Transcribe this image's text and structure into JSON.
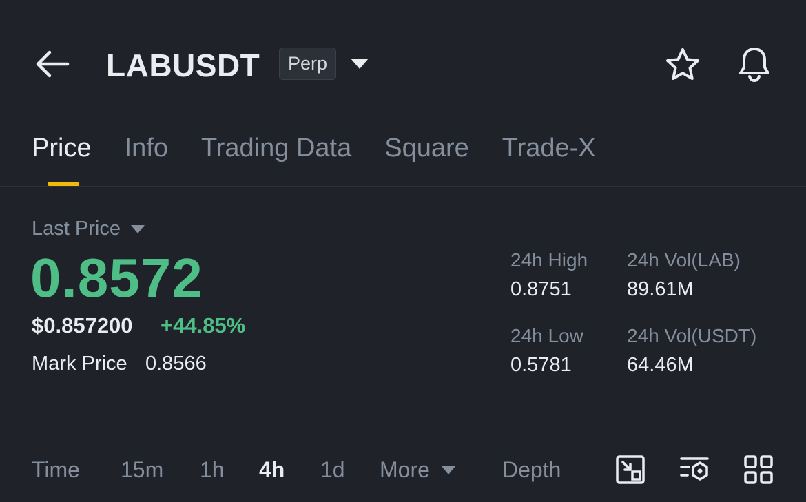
{
  "header": {
    "symbol": "LABUSDT",
    "badge": "Perp",
    "icons": [
      "arrow-left-icon",
      "caret-down-icon",
      "star-icon",
      "bell-icon"
    ]
  },
  "tabs": [
    {
      "label": "Price",
      "active": true
    },
    {
      "label": "Info"
    },
    {
      "label": "Trading Data"
    },
    {
      "label": "Square"
    },
    {
      "label": "Trade-X"
    }
  ],
  "price": {
    "last_label": "Last Price",
    "last_value": "0.8572",
    "usd_value": "$0.857200",
    "change_pct": "+44.85%",
    "mark_label": "Mark Price",
    "mark_value": "0.8566"
  },
  "stats": {
    "high_label": "24h High",
    "high_value": "0.8751",
    "vol_base_label": "24h Vol(LAB)",
    "vol_base_value": "89.61M",
    "low_label": "24h Low",
    "low_value": "0.5781",
    "vol_quote_label": "24h Vol(USDT)",
    "vol_quote_value": "64.46M"
  },
  "toolbar": {
    "items": [
      "Time",
      "15m",
      "1h",
      "4h",
      "1d"
    ],
    "active": "4h",
    "more": "More",
    "depth": "Depth",
    "icons": [
      "expand-chart-icon",
      "indicator-settings-icon",
      "grid-layout-icon"
    ]
  },
  "colors": {
    "background": "#1f2229",
    "up": "#4fbd86",
    "accent": "#f0b90b",
    "muted": "#848e9c"
  }
}
